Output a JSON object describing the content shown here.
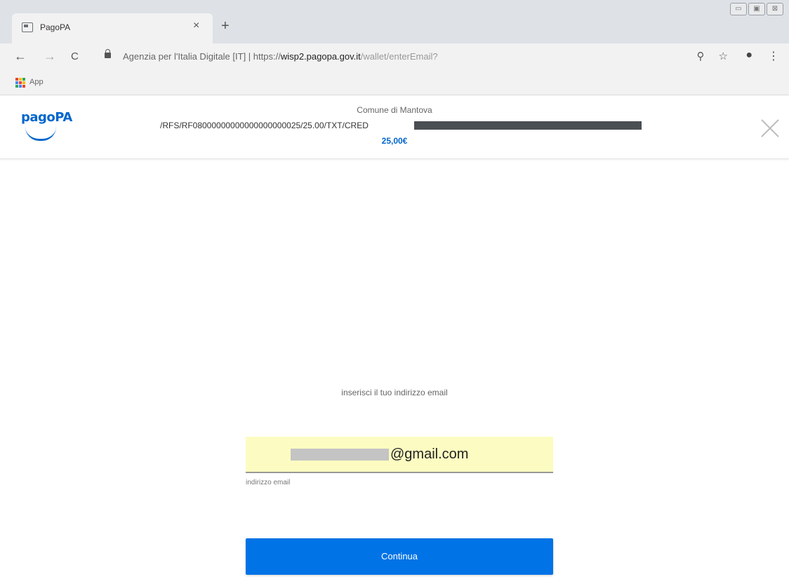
{
  "browser": {
    "tab": {
      "title": "PagoPA",
      "close": "×"
    },
    "new_tab": "+",
    "window_controls": [
      "▭",
      "▣",
      "⊠"
    ],
    "nav": {
      "back": "←",
      "forward": "→",
      "reload": "C"
    },
    "address": {
      "security_label": "Agenzia per l'Italia Digitale [IT]",
      "separator": " | ",
      "scheme": "https://",
      "host": "wisp2.pagopa.gov.it",
      "path": "/wallet/enterEmail?"
    },
    "omni_icons": [
      "search-icon",
      "star-icon"
    ],
    "toolbar_icons": [
      "account-icon",
      "menu-icon"
    ],
    "bookmarks": {
      "apps_label": "App"
    }
  },
  "payment_header": {
    "logo_text": "pagoPA",
    "merchant": "Comune di Mantova",
    "causale": "/RFS/RF08000000000000000000025/25.00/TXT/CRED",
    "amount": "25,00€"
  },
  "form": {
    "prompt": "inserisci il tuo indirizzo email",
    "email_visible": "@gmail.com",
    "email_label": "indirizzo email",
    "continue_label": "Continua"
  },
  "colors": {
    "brand_blue": "#0066cc",
    "button_blue": "#0073e6",
    "input_highlight": "#fcfcc2"
  }
}
